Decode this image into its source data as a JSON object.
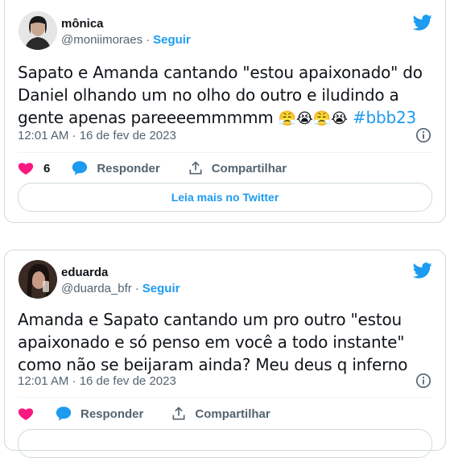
{
  "colors": {
    "accent": "#1d9bf0",
    "heart": "#f91880",
    "text": "#0f1419",
    "muted": "#536471"
  },
  "tweets": [
    {
      "name": "mônica",
      "handle": "@moniimoraes",
      "separator": "·",
      "follow_label": "Seguir",
      "text": "Sapato e Amanda cantando \"estou apaixonado\" do Daniel olhando um no olho do outro e iludindo a gente apenas pareeeemmmmm",
      "emojis": "😤😭😤😭",
      "hashtag": "#bbb23",
      "timestamp": "12:01 AM · 16 de fev de 2023",
      "like_count": "6",
      "reply_label": "Responder",
      "share_label": "Compartilhar",
      "read_more_label": "Leia mais no Twitter"
    },
    {
      "name": "eduarda",
      "handle": "@duarda_bfr",
      "separator": "·",
      "follow_label": "Seguir",
      "text": "Amanda e Sapato cantando um pro outro \"estou apaixonado e só penso em você a todo instante\" como não se beijaram ainda? Meu deus q inferno",
      "timestamp": "12:01 AM · 16 de fev de 2023",
      "reply_label": "Responder",
      "share_label": "Compartilhar"
    }
  ],
  "icons": [
    "twitter-bird-icon",
    "info-icon",
    "heart-icon",
    "reply-bubble-icon",
    "share-icon"
  ]
}
